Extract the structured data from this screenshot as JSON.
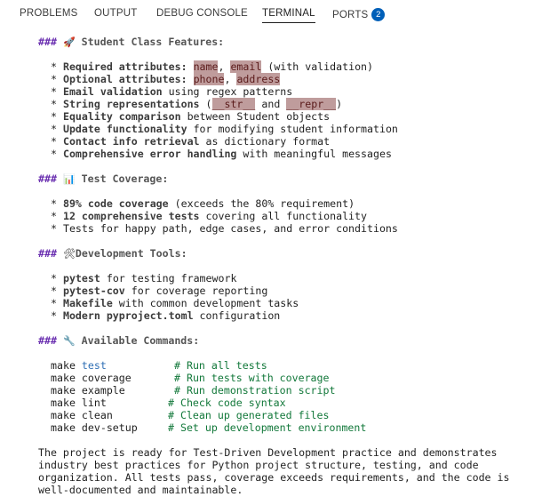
{
  "tabs": [
    {
      "label": "PROBLEMS"
    },
    {
      "label": "OUTPUT"
    },
    {
      "label": "DEBUG CONSOLE"
    },
    {
      "label": "TERMINAL"
    },
    {
      "label": "PORTS",
      "badge": "2"
    }
  ],
  "active_tab": "TERMINAL",
  "terminal": {
    "hash": "###",
    "bullet": "*",
    "sec1": {
      "icon": "🚀",
      "title": "Student Class Features:",
      "l1": {
        "b": "Required attributes:",
        "h1": "name",
        "sep": ",",
        "h2": "email",
        "t": "(with validation)"
      },
      "l2": {
        "b": "Optional attributes:",
        "h1": "phone",
        "sep": ",",
        "h2": "address"
      },
      "l3": {
        "b": "Email validation",
        "t": "using regex patterns"
      },
      "l4": {
        "b": "String representations",
        "open": "(",
        "h1": "__str__",
        "mid": "and",
        "h2": "__repr__",
        "close": ")"
      },
      "l5": {
        "b": "Equality comparison",
        "t": "between Student objects"
      },
      "l6": {
        "b": "Update functionality",
        "t": "for modifying student information"
      },
      "l7": {
        "b": "Contact info retrieval",
        "t": "as dictionary format"
      },
      "l8": {
        "b": "Comprehensive error handling",
        "t": "with meaningful messages"
      }
    },
    "sec2": {
      "icon": "📊",
      "title": "Test Coverage:",
      "l1": {
        "b": "89% code coverage",
        "t": "(exceeds the 80% requirement)"
      },
      "l2": {
        "b": "12 comprehensive tests",
        "t": "covering all functionality"
      },
      "l3": {
        "t": "Tests for happy path, edge cases, and error conditions"
      }
    },
    "sec3": {
      "icon": "🛠",
      "title": "Development Tools:",
      "l1": {
        "b": "pytest",
        "t": "for testing framework"
      },
      "l2": {
        "b": "pytest-cov",
        "t": "for coverage reporting"
      },
      "l3": {
        "b": "Makefile",
        "t": "with common development tasks"
      },
      "l4": {
        "b": "Modern pyproject.toml",
        "t": "configuration"
      }
    },
    "sec4": {
      "icon": "🔧",
      "title": "Available Commands:",
      "commands": [
        {
          "make": "make",
          "target": "test",
          "comment": "# Run all tests"
        },
        {
          "make": "make",
          "target": "coverage",
          "comment": "# Run tests with coverage"
        },
        {
          "make": "make",
          "target": "example",
          "comment": "# Run demonstration script"
        },
        {
          "make": "make",
          "target": "lint",
          "comment": "# Check code syntax"
        },
        {
          "make": "make",
          "target": "clean",
          "comment": "# Clean up generated files"
        },
        {
          "make": "make",
          "target": "dev-setup",
          "comment": "# Set up development environment"
        }
      ]
    },
    "summary": [
      "The project is ready for Test-Driven Development practice and demonstrates",
      "industry best practices for Python project structure, testing, and code",
      "organization. All tests pass, coverage exceeds requirements, and the code is",
      "well-documented and maintainable."
    ]
  }
}
